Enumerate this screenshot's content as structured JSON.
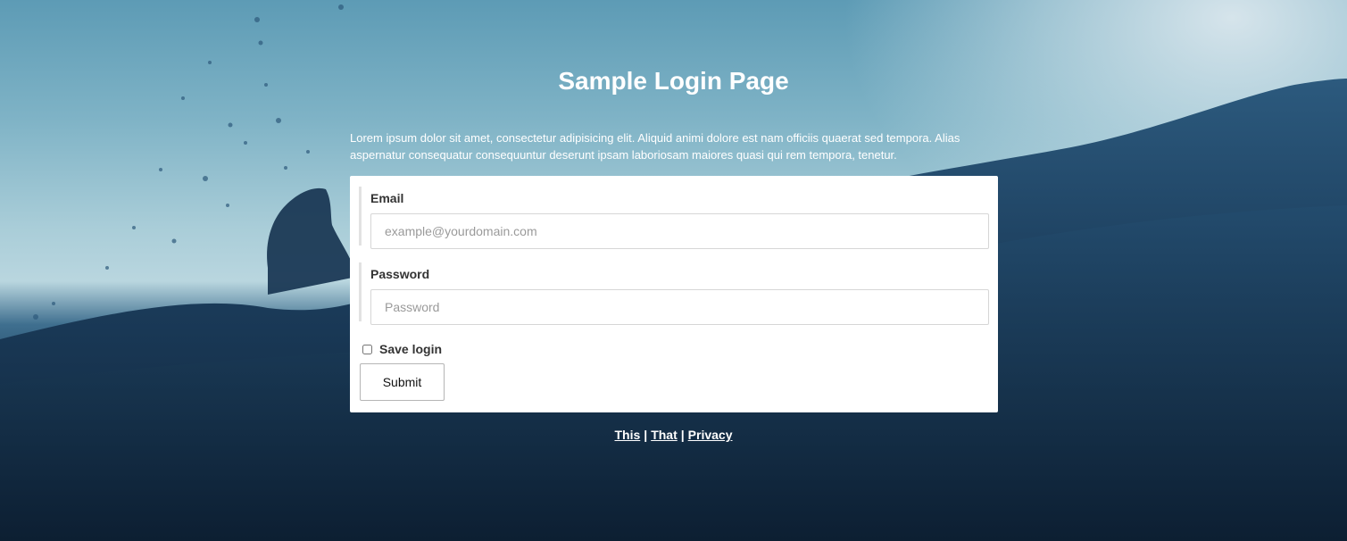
{
  "page": {
    "title": "Sample Login Page",
    "intro": "Lorem ipsum dolor sit amet, consectetur adipisicing elit. Aliquid animi dolore est nam officiis quaerat sed tempora. Alias aspernatur consequatur consequuntur deserunt ipsam laboriosam maiores quasi qui rem tempora, tenetur."
  },
  "form": {
    "email": {
      "label": "Email",
      "placeholder": "example@yourdomain.com",
      "value": ""
    },
    "password": {
      "label": "Password",
      "placeholder": "Password",
      "value": ""
    },
    "save_login": {
      "label": "Save login",
      "checked": false
    },
    "submit_label": "Submit"
  },
  "footer": {
    "links": [
      "This",
      "That",
      "Privacy"
    ],
    "separator": "|"
  },
  "colors": {
    "text_on_bg": "#ffffff",
    "card_bg": "#ffffff",
    "field_border": "#d6d6d6"
  }
}
